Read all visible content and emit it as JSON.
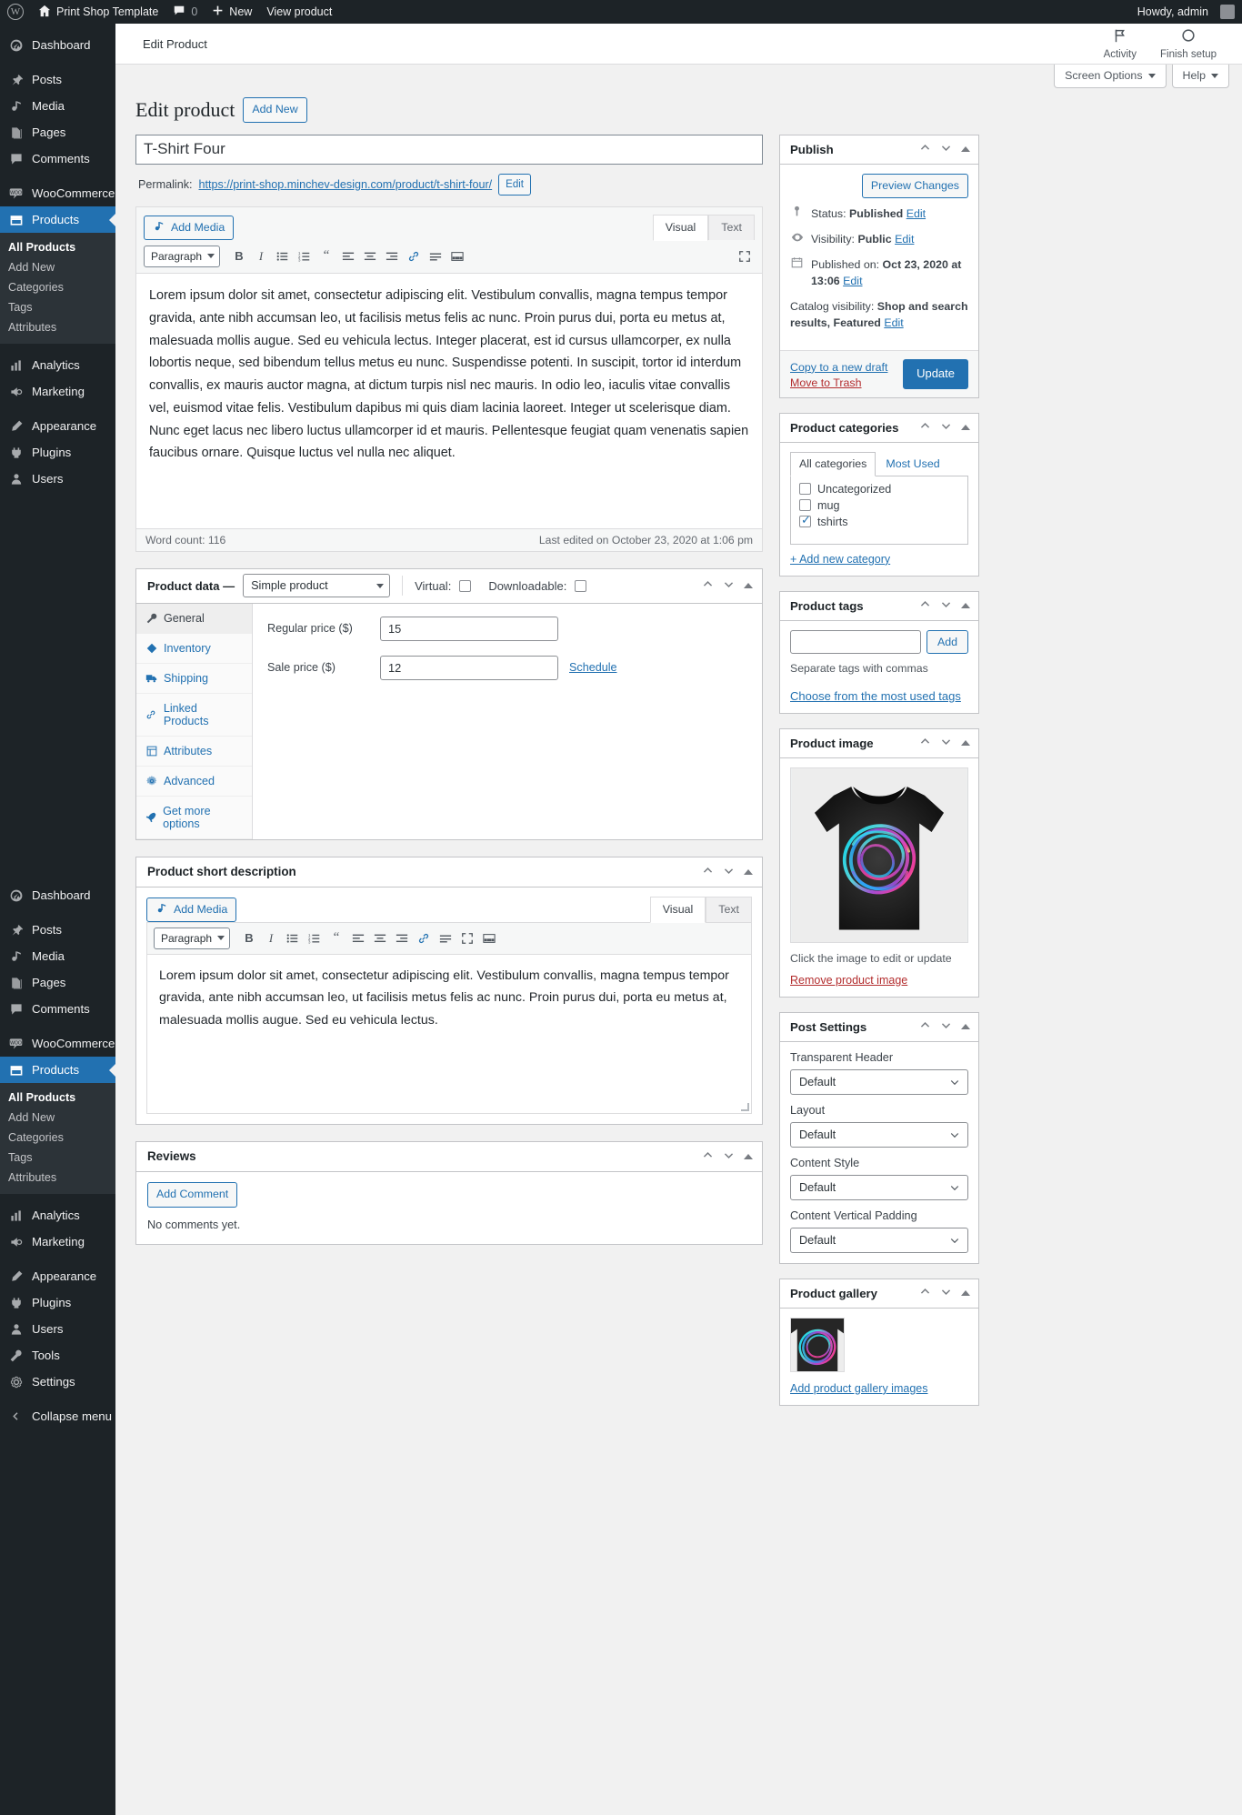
{
  "adminbar": {
    "site_name": "Print Shop Template",
    "comment_count": "0",
    "new_label": "New",
    "view_product": "View product",
    "howdy": "Howdy, admin"
  },
  "sidebar": {
    "groups": [
      {
        "items": [
          {
            "label": "Dashboard",
            "icon": "dashboard-icon",
            "current": false
          }
        ]
      },
      {
        "items": [
          {
            "label": "Posts",
            "icon": "pin-icon",
            "current": false
          },
          {
            "label": "Media",
            "icon": "media-icon",
            "current": false
          },
          {
            "label": "Pages",
            "icon": "pages-icon",
            "current": false
          },
          {
            "label": "Comments",
            "icon": "comments-icon",
            "current": false
          }
        ]
      },
      {
        "items": [
          {
            "label": "WooCommerce",
            "icon": "woo-icon",
            "current": false
          },
          {
            "label": "Products",
            "icon": "products-icon",
            "current": true
          }
        ]
      }
    ],
    "products_submenu": [
      {
        "label": "All Products",
        "current": true
      },
      {
        "label": "Add New",
        "current": false
      },
      {
        "label": "Categories",
        "current": false
      },
      {
        "label": "Tags",
        "current": false
      },
      {
        "label": "Attributes",
        "current": false
      }
    ],
    "lower_items": [
      {
        "label": "Analytics",
        "icon": "analytics-icon"
      },
      {
        "label": "Marketing",
        "icon": "marketing-icon"
      },
      {
        "label": "Appearance",
        "icon": "appearance-icon"
      },
      {
        "label": "Plugins",
        "icon": "plugins-icon"
      },
      {
        "label": "Users",
        "icon": "users-icon"
      },
      {
        "label": "Tools",
        "icon": "tools-icon"
      },
      {
        "label": "Settings",
        "icon": "settings-icon"
      }
    ],
    "collapse_label": "Collapse menu"
  },
  "wcbar": {
    "breadcrumb": "Edit Product",
    "activity": "Activity",
    "finish_setup": "Finish setup"
  },
  "screenmeta": {
    "screen_options": "Screen Options",
    "help": "Help"
  },
  "page": {
    "title": "Edit product",
    "add_new": "Add New"
  },
  "post": {
    "title_value": "T-Shirt Four",
    "permalink_label": "Permalink:",
    "permalink_url": "https://print-shop.minchev-design.com/product/t-shirt-four/",
    "permalink_edit": "Edit"
  },
  "editor": {
    "add_media": "Add Media",
    "tab_visual": "Visual",
    "tab_text": "Text",
    "format_select": "Paragraph",
    "content": "Lorem ipsum dolor sit amet, consectetur adipiscing elit. Vestibulum convallis, magna tempus tempor gravida, ante nibh accumsan leo, ut facilisis metus felis ac nunc. Proin purus dui, porta eu metus at, malesuada mollis augue. Sed eu vehicula lectus. Integer placerat, est id cursus ullamcorper, ex nulla lobortis neque, sed bibendum tellus metus eu nunc. Suspendisse potenti. In suscipit, tortor id interdum convallis, ex mauris auctor magna, at dictum turpis nisl nec mauris. In odio leo, iaculis vitae convallis vel, euismod vitae felis. Vestibulum dapibus mi quis diam lacinia laoreet. Integer ut scelerisque diam. Nunc eget lacus nec libero luctus ullamcorper id et mauris. Pellentesque feugiat quam venenatis sapien faucibus ornare. Quisque luctus vel nulla nec aliquet.",
    "word_count": "Word count: 116",
    "last_edited": "Last edited on October 23, 2020 at 1:06 pm"
  },
  "product_data": {
    "heading": "Product data —",
    "type_value": "Simple product",
    "virtual_label": "Virtual:",
    "downloadable_label": "Downloadable:",
    "tabs": [
      {
        "label": "General",
        "icon": "wrench-icon",
        "active": true
      },
      {
        "label": "Inventory",
        "icon": "tag-icon",
        "active": false
      },
      {
        "label": "Shipping",
        "icon": "truck-icon",
        "active": false
      },
      {
        "label": "Linked Products",
        "icon": "link-icon",
        "active": false
      },
      {
        "label": "Attributes",
        "icon": "list-icon",
        "active": false
      },
      {
        "label": "Advanced",
        "icon": "gear-icon",
        "active": false
      },
      {
        "label": "Get more options",
        "icon": "rocket-icon",
        "active": false
      }
    ],
    "regular_price_label": "Regular price ($)",
    "regular_price_value": "15",
    "sale_price_label": "Sale price ($)",
    "sale_price_value": "12",
    "schedule_link": "Schedule"
  },
  "short_description": {
    "heading": "Product short description",
    "add_media": "Add Media",
    "tab_visual": "Visual",
    "tab_text": "Text",
    "format_select": "Paragraph",
    "content": "Lorem ipsum dolor sit amet, consectetur adipiscing elit. Vestibulum convallis, magna tempus tempor gravida, ante nibh accumsan leo, ut facilisis metus felis ac nunc. Proin purus dui, porta eu metus at, malesuada mollis augue. Sed eu vehicula lectus."
  },
  "reviews": {
    "heading": "Reviews",
    "add_comment": "Add Comment",
    "empty": "No comments yet."
  },
  "publish": {
    "heading": "Publish",
    "preview_changes": "Preview Changes",
    "status_label": "Status:",
    "status_value": "Published",
    "status_edit": "Edit",
    "visibility_label": "Visibility:",
    "visibility_value": "Public",
    "visibility_edit": "Edit",
    "published_label": "Published on:",
    "published_value": "Oct 23, 2020 at 13:06",
    "published_edit": "Edit",
    "catalog_label": "Catalog visibility:",
    "catalog_value": "Shop and search results, Featured",
    "catalog_edit": "Edit",
    "copy_draft": "Copy to a new draft",
    "move_trash": "Move to Trash",
    "update": "Update"
  },
  "categories_box": {
    "heading": "Product categories",
    "tab_all": "All categories",
    "tab_most_used": "Most Used",
    "items": [
      {
        "label": "Uncategorized",
        "checked": false
      },
      {
        "label": "mug",
        "checked": false
      },
      {
        "label": "tshirts",
        "checked": true
      }
    ],
    "add_new": "+ Add new category"
  },
  "tags_box": {
    "heading": "Product tags",
    "input_value": "",
    "add_label": "Add",
    "hint": "Separate tags with commas",
    "most_used_link": "Choose from the most used tags"
  },
  "product_image": {
    "heading": "Product image",
    "caption": "Click the image to edit or update",
    "remove_link": "Remove product image"
  },
  "post_settings": {
    "heading": "Post Settings",
    "fields": [
      {
        "label": "Transparent Header",
        "value": "Default"
      },
      {
        "label": "Layout",
        "value": "Default"
      },
      {
        "label": "Content Style",
        "value": "Default"
      },
      {
        "label": "Content Vertical Padding",
        "value": "Default"
      }
    ]
  },
  "product_gallery": {
    "heading": "Product gallery",
    "add_link": "Add product gallery images"
  },
  "colors": {
    "admin_bg": "#1d2327",
    "accent": "#2271b1",
    "danger": "#b32d2e",
    "page_bg": "#f1f1f1"
  }
}
